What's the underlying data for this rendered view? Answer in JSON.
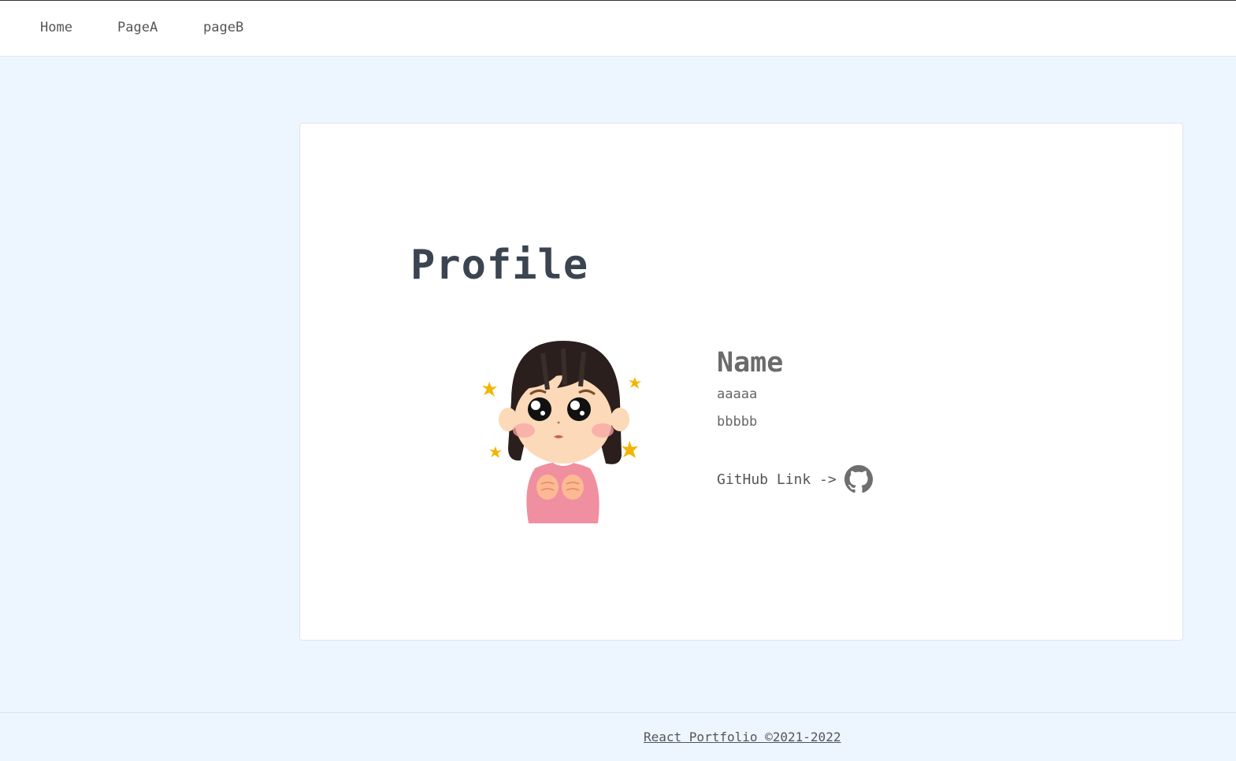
{
  "nav": {
    "items": [
      {
        "label": "Home"
      },
      {
        "label": "PageA"
      },
      {
        "label": "pageB"
      }
    ]
  },
  "profile": {
    "title": "Profile",
    "name_heading": "Name",
    "line1": "aaaaa",
    "line2": "bbbbb",
    "github_label": "GitHub Link ->",
    "github_icon": "github-icon"
  },
  "footer": {
    "text": "React Portfolio ©2021-2022"
  },
  "colors": {
    "background": "#edf5fe",
    "card": "#ffffff",
    "title": "#3b4451",
    "text": "#666666"
  }
}
